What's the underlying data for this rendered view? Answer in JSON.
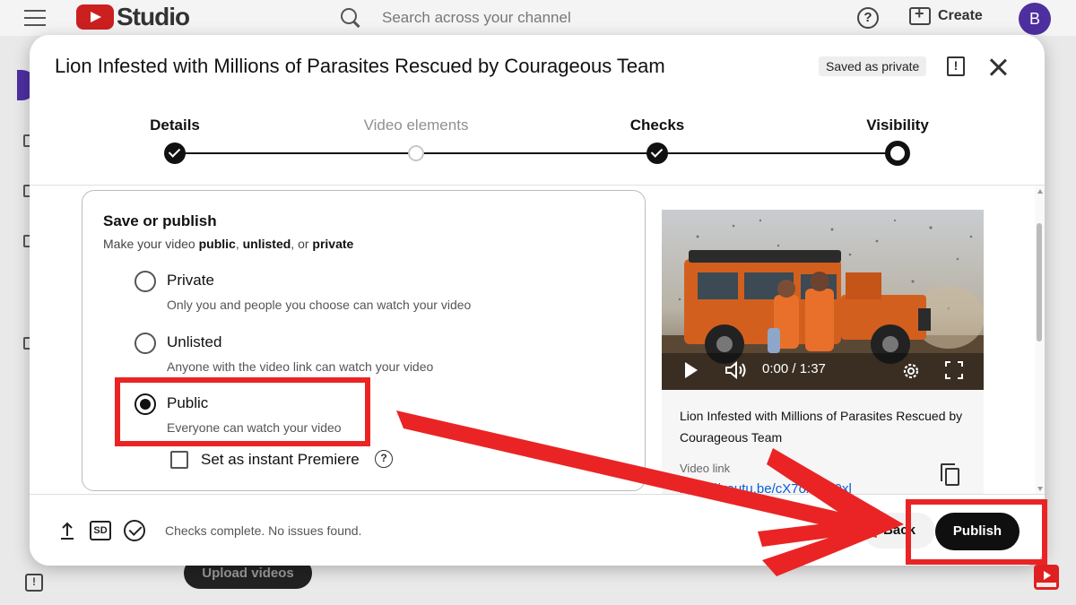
{
  "app": {
    "brand": "Studio",
    "search_placeholder": "Search across your channel",
    "help_glyph": "?",
    "create_label": "Create",
    "avatar_letter": "B",
    "upload_button": "Upload videos"
  },
  "dialog": {
    "title": "Lion Infested with Millions of Parasites Rescued by Courageous Team",
    "saved_badge": "Saved as private",
    "report_glyph": "!",
    "steps": [
      {
        "label": "Details",
        "state": "done"
      },
      {
        "label": "Video elements",
        "state": "pending"
      },
      {
        "label": "Checks",
        "state": "done"
      },
      {
        "label": "Visibility",
        "state": "current"
      }
    ],
    "publish_card": {
      "heading": "Save or publish",
      "sub_prefix": "Make your video ",
      "sub_public": "public",
      "sub_sep1": ", ",
      "sub_unlisted": "unlisted",
      "sub_sep2": ", or ",
      "sub_private": "private",
      "options": [
        {
          "label": "Private",
          "desc": "Only you and people you choose can watch your video",
          "selected": false
        },
        {
          "label": "Unlisted",
          "desc": "Anyone with the video link can watch your video",
          "selected": false
        },
        {
          "label": "Public",
          "desc": "Everyone can watch your video",
          "selected": true
        }
      ],
      "premiere_label": "Set as instant Premiere",
      "premiere_help": "?"
    },
    "preview": {
      "time": "0:00 / 1:37",
      "title": "Lion Infested with Millions of Parasites Rescued by Courageous Team",
      "link_label": "Video link",
      "link_value": "https://youtu.be/cX7oXnKi9xl"
    },
    "footer": {
      "sd_label": "SD",
      "checks_text": "Checks complete. No issues found.",
      "back_label": "Back",
      "publish_label": "Publish"
    }
  },
  "colors": {
    "accent_red": "#ea2424",
    "brand_red": "#cc1f1f",
    "link_blue": "#065fd4",
    "avatar_purple": "#4d2fa0"
  },
  "icons": [
    "hamburger-icon",
    "search-icon",
    "help-icon",
    "create-icon",
    "close-icon",
    "report-icon",
    "play-icon",
    "volume-icon",
    "settings-icon",
    "fullscreen-icon",
    "copy-icon",
    "upload-icon",
    "sd-icon",
    "check-circle-icon"
  ]
}
